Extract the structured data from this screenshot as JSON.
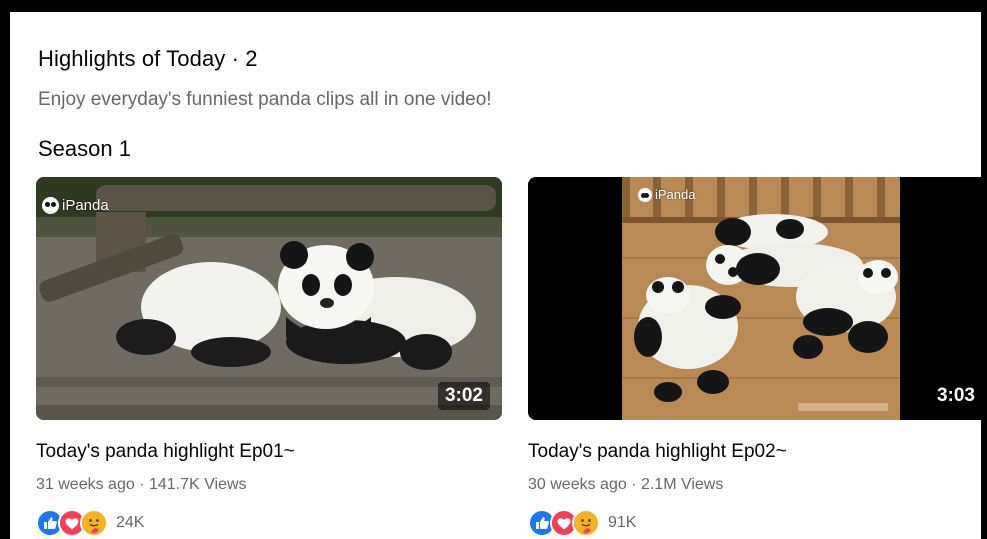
{
  "section": {
    "title": "Highlights of Today · 2",
    "subtitle": "Enjoy everyday's funniest panda clips all in one video!",
    "season_label": "Season 1"
  },
  "videos": [
    {
      "watermark": "iPanda",
      "duration": "3:02",
      "title": "Today's panda highlight Ep01~",
      "meta": "31 weeks ago · 141.7K Views",
      "reactions": {
        "icons": [
          "like-icon",
          "love-icon",
          "care-icon"
        ],
        "count": "24K"
      }
    },
    {
      "watermark": "iPanda",
      "duration": "3:03",
      "title": "Today's panda highlight Ep02~",
      "meta": "30 weeks ago · 2.1M Views",
      "reactions": {
        "icons": [
          "like-icon",
          "love-icon",
          "care-icon"
        ],
        "count": "91K"
      }
    }
  ],
  "colors": {
    "like": "#1877f2",
    "love": "#f33e58",
    "care": "#f7b125",
    "secondary_text": "#65676b"
  }
}
